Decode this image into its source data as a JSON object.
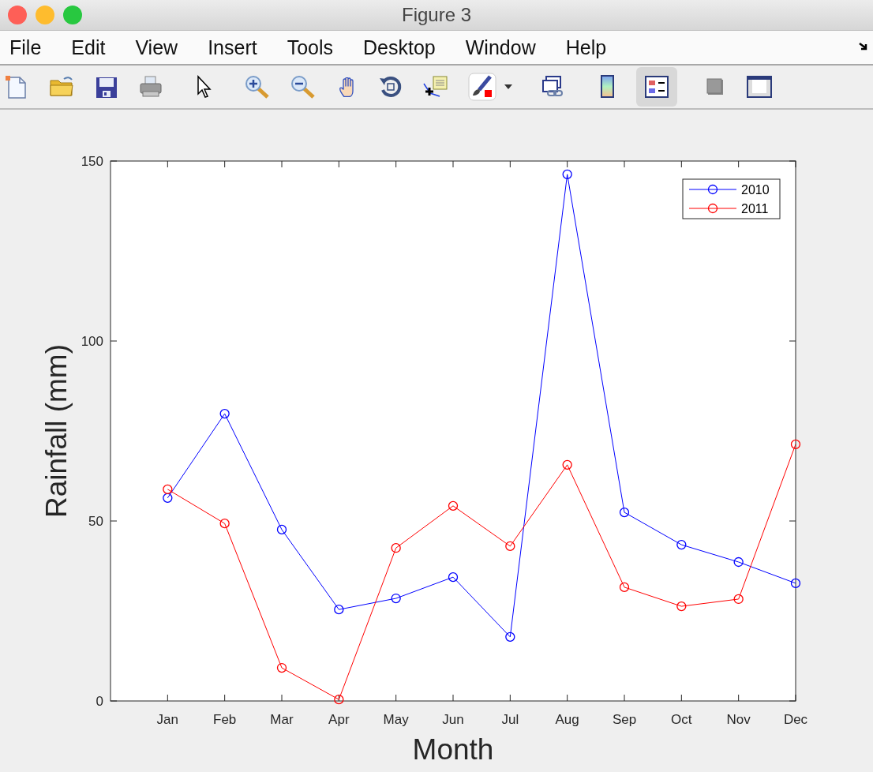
{
  "window": {
    "title": "Figure 3"
  },
  "menu": [
    "File",
    "Edit",
    "View",
    "Insert",
    "Tools",
    "Desktop",
    "Window",
    "Help"
  ],
  "toolbar": {
    "groups": [
      [
        {
          "kind": "new",
          "selected": false
        },
        {
          "kind": "open",
          "selected": false
        },
        {
          "kind": "save",
          "selected": false
        },
        {
          "kind": "print",
          "selected": false
        }
      ],
      [
        {
          "kind": "pointer",
          "selected": false
        }
      ],
      [
        {
          "kind": "zoom-in",
          "selected": false
        },
        {
          "kind": "zoom-out",
          "selected": false
        },
        {
          "kind": "pan",
          "selected": false
        },
        {
          "kind": "rotate",
          "selected": false
        },
        {
          "kind": "data-cursor",
          "selected": false
        },
        {
          "kind": "brush",
          "selected": false
        },
        {
          "kind": "dropdown",
          "selected": false
        }
      ],
      [
        {
          "kind": "link",
          "selected": false
        }
      ],
      [
        {
          "kind": "colorbar",
          "selected": false
        },
        {
          "kind": "legend",
          "selected": true
        }
      ],
      [
        {
          "kind": "hide-tools",
          "selected": false
        },
        {
          "kind": "show-tools",
          "selected": false
        }
      ]
    ]
  },
  "chart_data": {
    "type": "line",
    "xlabel": "Month",
    "ylabel": "Rainfall (mm)",
    "categories": [
      "Jan",
      "Feb",
      "Mar",
      "Apr",
      "May",
      "Jun",
      "Jul",
      "Aug",
      "Sep",
      "Oct",
      "Nov",
      "Dec"
    ],
    "legend": true,
    "ylim": [
      0,
      150
    ],
    "yticks": [
      0,
      50,
      100,
      150
    ],
    "series": [
      {
        "name": "2010",
        "color": "#0000ff",
        "marker": "o",
        "values": [
          56.4,
          79.8,
          47.6,
          25.4,
          28.5,
          34.4,
          17.8,
          146.3,
          52.4,
          43.4,
          38.6,
          32.7
        ]
      },
      {
        "name": "2011",
        "color": "#ff0000",
        "marker": "o",
        "values": [
          58.8,
          49.3,
          9.2,
          0.4,
          42.5,
          54.2,
          43.0,
          65.6,
          31.6,
          26.3,
          28.3,
          71.3
        ]
      }
    ]
  }
}
